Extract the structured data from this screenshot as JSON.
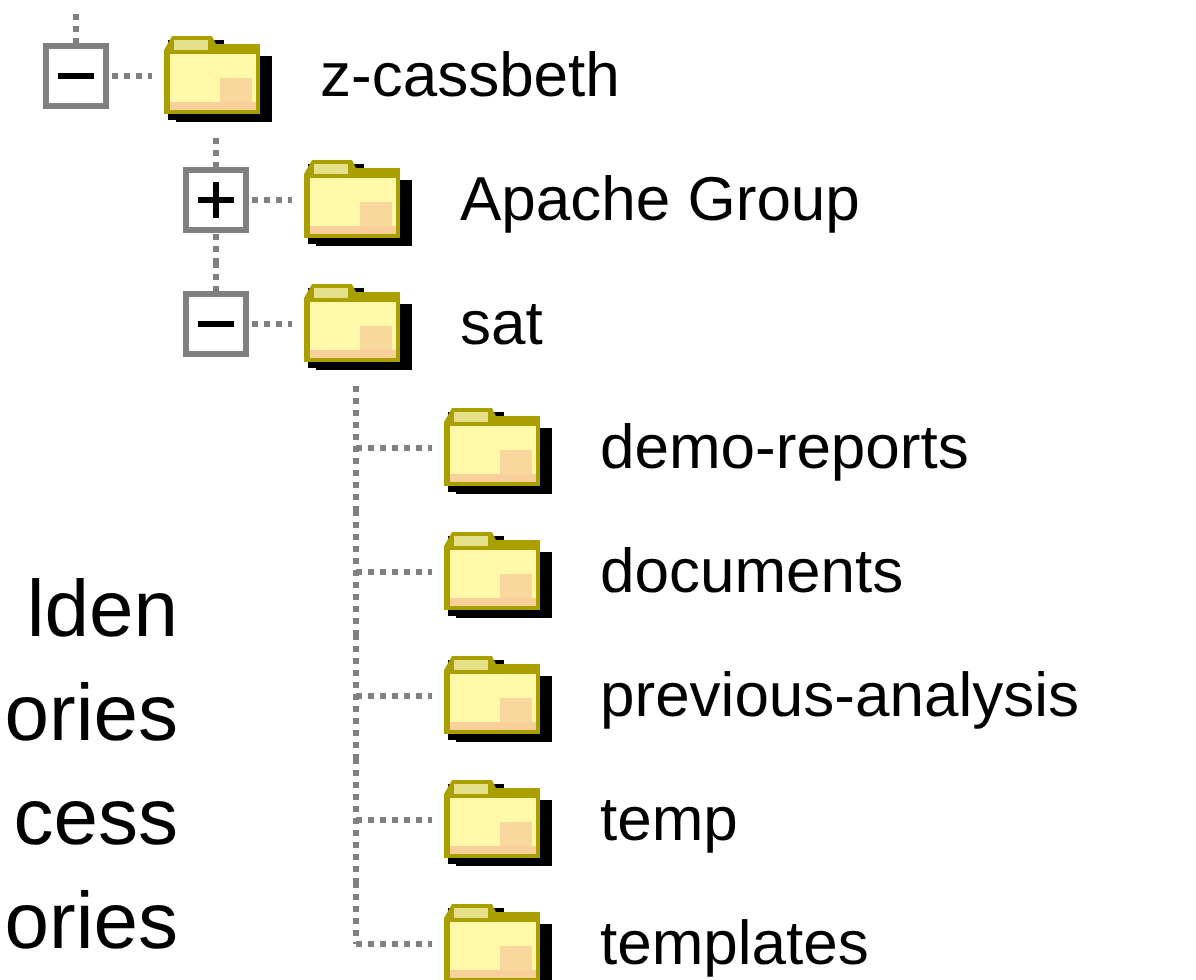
{
  "tree": [
    {
      "label": "z-cassbeth",
      "expanded": true,
      "children": [
        {
          "label": "Apache Group",
          "expanded": false
        },
        {
          "label": "sat",
          "expanded": true,
          "children": [
            {
              "label": "demo-reports"
            },
            {
              "label": "documents"
            },
            {
              "label": "previous-analysis"
            },
            {
              "label": "temp"
            },
            {
              "label": "templates"
            }
          ]
        }
      ]
    }
  ],
  "slide_text": [
    "lden",
    "ories",
    "cess",
    "ories"
  ]
}
